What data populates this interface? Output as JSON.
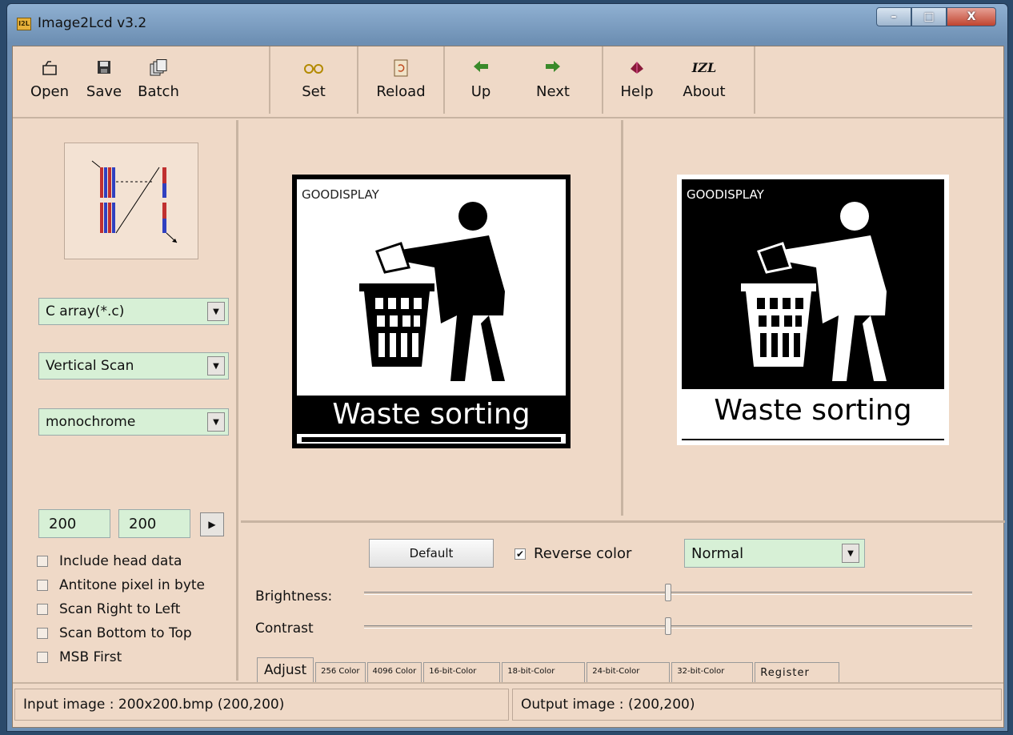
{
  "window": {
    "title": "Image2Lcd v3.2",
    "icon_text": "I2L",
    "buttons": {
      "minimize": "–",
      "maximize": "□",
      "close": "X"
    }
  },
  "toolbar": {
    "groups": [
      [
        {
          "label": "Open",
          "icon": "open-icon"
        },
        {
          "label": "Save",
          "icon": "save-icon"
        },
        {
          "label": "Batch",
          "icon": "batch-icon"
        }
      ],
      [
        {
          "label": "Set",
          "icon": "set-icon"
        }
      ],
      [
        {
          "label": "Reload",
          "icon": "reload-icon"
        }
      ],
      [
        {
          "label": "Up",
          "icon": "up-arrow-icon"
        },
        {
          "label": "Next",
          "icon": "next-arrow-icon"
        }
      ],
      [
        {
          "label": "Help",
          "icon": "help-icon"
        },
        {
          "label": "About",
          "icon": "about-icon"
        }
      ]
    ],
    "about_glyph": "IZL"
  },
  "left": {
    "output_type": "C array(*.c)",
    "scan_mode": "Vertical Scan",
    "gray_scale": "monochrome",
    "width": "200",
    "height": "200",
    "options": [
      {
        "label": "Include head data",
        "checked": false
      },
      {
        "label": "Antitone pixel in byte",
        "checked": false
      },
      {
        "label": "Scan Right to Left",
        "checked": false
      },
      {
        "label": "Scan Bottom to Top",
        "checked": false
      },
      {
        "label": "MSB First",
        "checked": false
      }
    ]
  },
  "images": {
    "brand": "GOODISPLAY",
    "caption": "Waste sorting"
  },
  "controls": {
    "default_label": "Default",
    "reverse_label": "Reverse color",
    "reverse_checked": true,
    "mode": "Normal",
    "brightness_label": "Brightness:",
    "contrast_label": "Contrast",
    "brightness_level": 0.5,
    "contrast_level": 0.5,
    "tabs": [
      "Adjust",
      "256 Color",
      "4096 Color",
      "16-bit-Color",
      "18-bit-Color",
      "24-bit-Color",
      "32-bit-Color",
      "Register"
    ]
  },
  "status": {
    "input": "Input image :   200x200.bmp (200,200)",
    "output": "Output image : (200,200)"
  },
  "colors": {
    "field_green": "#d7f0d6",
    "panel": "#efd9c7"
  }
}
